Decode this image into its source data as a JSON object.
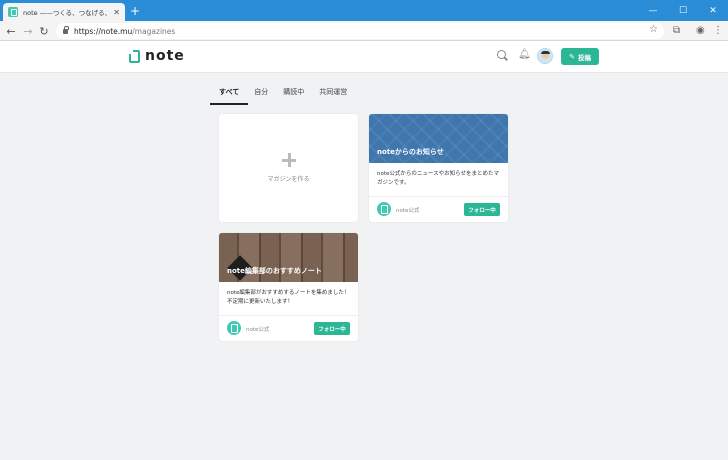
{
  "browser": {
    "tab_title": "note ——つくる、つなげる、とどける。",
    "url_host": "https://note.mu",
    "url_path": "/magazines"
  },
  "header": {
    "logo_text": "note",
    "post_label": "投稿"
  },
  "tabs": [
    {
      "label": "すべて",
      "active": true
    },
    {
      "label": "自分",
      "active": false
    },
    {
      "label": "購読中",
      "active": false
    },
    {
      "label": "共同運営",
      "active": false
    }
  ],
  "create_card": {
    "label": "マガジンを作る"
  },
  "magazines": [
    {
      "title": "noteからのお知らせ",
      "description": "note公式からのニュースやお知らせをまとめたマガジンです。",
      "author": "note公式",
      "follow_label": "フォロー中",
      "cover": "blue"
    },
    {
      "title": "note編集部のおすすめノート",
      "description": "note編集部がおすすめするノートを集めました！不定期に更新いたします！",
      "author": "note公式",
      "follow_label": "フォロー中",
      "cover": "wood"
    }
  ],
  "colors": {
    "brand": "#2cb696",
    "chrome": "#2b8cd8"
  }
}
